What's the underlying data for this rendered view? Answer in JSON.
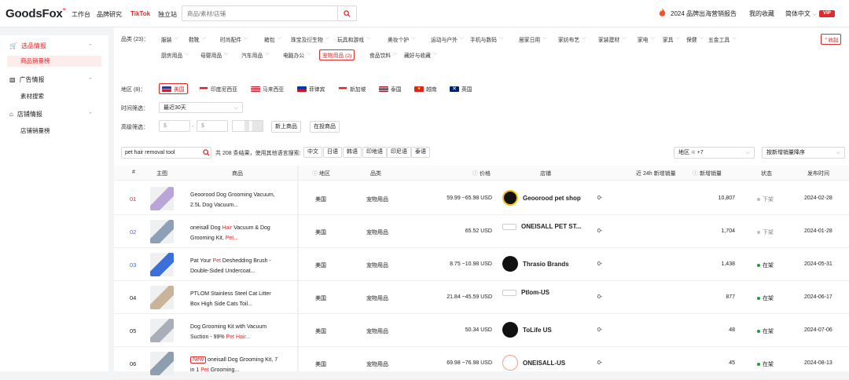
{
  "app": {
    "logo": "GoodsFox",
    "nav": [
      "工作台",
      "品牌研究",
      "TikTok",
      "独立站"
    ],
    "search_placeholder": "商品/素材/店铺",
    "top_right": [
      "2024 品牌出海营销报告",
      "我的收藏",
      "简体中文"
    ],
    "vip": "VIP"
  },
  "sidebar": {
    "groups": [
      {
        "label": "选品情报",
        "items": [
          "商品销量榜"
        ]
      },
      {
        "label": "广告情报",
        "items": [
          "素材搜索"
        ]
      },
      {
        "label": "店铺情报",
        "items": [
          "店铺销量榜"
        ]
      }
    ]
  },
  "filters": {
    "category_label": "品类 (23)：",
    "categories_row1": [
      "服装",
      "鞋靴",
      "时尚配件",
      "箱包",
      "珠宝及衍生物",
      "玩具和游戏",
      "美妆个护",
      "运动与户外",
      "手机与数码",
      "居家日用",
      "家纺布艺",
      "家装建材",
      "家电",
      "家具",
      "保健",
      "五金工具"
    ],
    "categories_row2": [
      "厨房用品",
      "母婴用品",
      "汽车用品",
      "电脑办公",
      "宠物用品 (2)",
      "食品饮料",
      "藏好与收藏"
    ],
    "expand": "收起",
    "region_label": "地区 (8)：",
    "regions": [
      "美国",
      "印度尼西亚",
      "马来西亚",
      "菲律宾",
      "新加坡",
      "泰国",
      "越南",
      "英国"
    ],
    "time_label": "时间筛选：",
    "time_value": "最近30天",
    "adv_label": "高级筛选：",
    "price_min": "$",
    "price_max": "$",
    "tag_new": "新上商品",
    "tag_onsale": "在投商品"
  },
  "search": {
    "keyword": "pet hair removal tool",
    "result_text": "共 208 条结果，使用其他语言搜索:",
    "langs": [
      "中文",
      "日语",
      "韩语",
      "印地语",
      "印尼语",
      "泰语"
    ],
    "region_select": "地区",
    "region_extra": "+7",
    "sort": "按新增销量降序"
  },
  "table": {
    "headers": [
      "#",
      "主图",
      "商品",
      "地区",
      "品类",
      "价格",
      "店铺",
      "近 24h 新增销量",
      "新增销量",
      "状态",
      "发布时间"
    ],
    "rows": [
      {
        "idx": "01",
        "name": "Geoorood Dog Grooming Vacuum, 2.5L Dog Vacuum...",
        "hl": "",
        "new": "",
        "region": "美国",
        "category": "宠物用品",
        "price": "59.99 ~65.98 USD",
        "store": "Geoorood pet shop",
        "h24": "0-",
        "sales": "10,807",
        "status": "下架",
        "date": "2024-02-28"
      },
      {
        "idx": "02",
        "name": "oneisall Dog ",
        "hl": "Hair",
        "name2": " Vacuum & Dog Grooming Kit, ",
        "hl2": "Pet...",
        "new": "",
        "region": "美国",
        "category": "宠物用品",
        "price": "65.52 USD",
        "store": "ONEISALL PET ST...",
        "h24": "0-",
        "sales": "1,704",
        "status": "下架",
        "date": "2024-01-28"
      },
      {
        "idx": "03",
        "name": "Pat Your ",
        "hl": "Pet",
        "name2": " Deshedding Brush - Double-Sided Undercoat...",
        "hl2": "",
        "new": "",
        "region": "美国",
        "category": "宠物用品",
        "price": "8.75 ~10.98 USD",
        "store": "Thrasio Brands",
        "h24": "0-",
        "sales": "1,438",
        "status": "在架",
        "date": "2024-05-31"
      },
      {
        "idx": "04",
        "name": "PTLOM Stainless Steel Cat Litter Box High Side Cats Toil...",
        "hl": "",
        "new": "",
        "region": "美国",
        "category": "宠物用品",
        "price": "21.84 ~45.59 USD",
        "store": "Ptlom-US",
        "h24": "0-",
        "sales": "877",
        "status": "在架",
        "date": "2024-06-17"
      },
      {
        "idx": "05",
        "name": "Dog Grooming Kit with Vacuum Suction - 99% ",
        "hl": "Pet Hair...",
        "new": "",
        "region": "美国",
        "category": "宠物用品",
        "price": "50.34 USD",
        "store": "ToLife US",
        "h24": "0-",
        "sales": "48",
        "status": "在架",
        "date": "2024-07-06"
      },
      {
        "idx": "06",
        "name": "oneisall Dog Grooming Kit, 7 in 1 ",
        "hl": "Pet",
        "name2": " Grooming...",
        "new": "New",
        "region": "美国",
        "category": "宠物用品",
        "price": "69.98 ~76.98 USD",
        "store": "ONEISALL-US",
        "h24": "0-",
        "sales": "45",
        "status": "在架",
        "date": "2024-08-13"
      }
    ]
  },
  "colors": {
    "accent": "#e02b2b",
    "active_status": "#1a9e3a",
    "inactive_status": "#bbbbbb"
  }
}
